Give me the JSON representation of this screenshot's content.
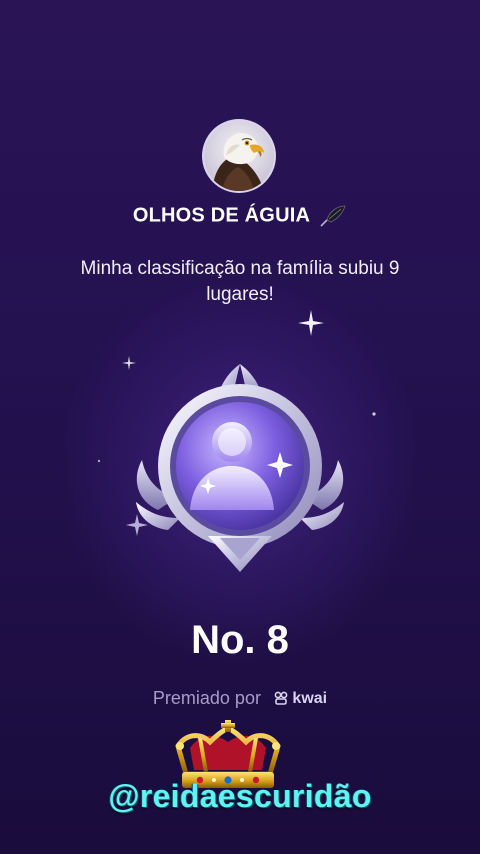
{
  "profile": {
    "name": "OLHOS DE ÁGUIA",
    "avatar_icon": "eagle-avatar-icon",
    "name_emoji_icon": "black-feather-icon"
  },
  "message": "Minha classificação na família subiu 9 lugares!",
  "badge": {
    "icon": "rank-medal-icon"
  },
  "rank_label": "No. 8",
  "awarded_by": {
    "prefix": "Premiado por",
    "brand": "kwai"
  },
  "watermark": {
    "handle": "@reidaescuridão",
    "crown_icon": "gold-crown-icon"
  },
  "colors": {
    "background": "#221150",
    "handle": "#5ff3f3",
    "awarded_text": "#a89cc8"
  }
}
